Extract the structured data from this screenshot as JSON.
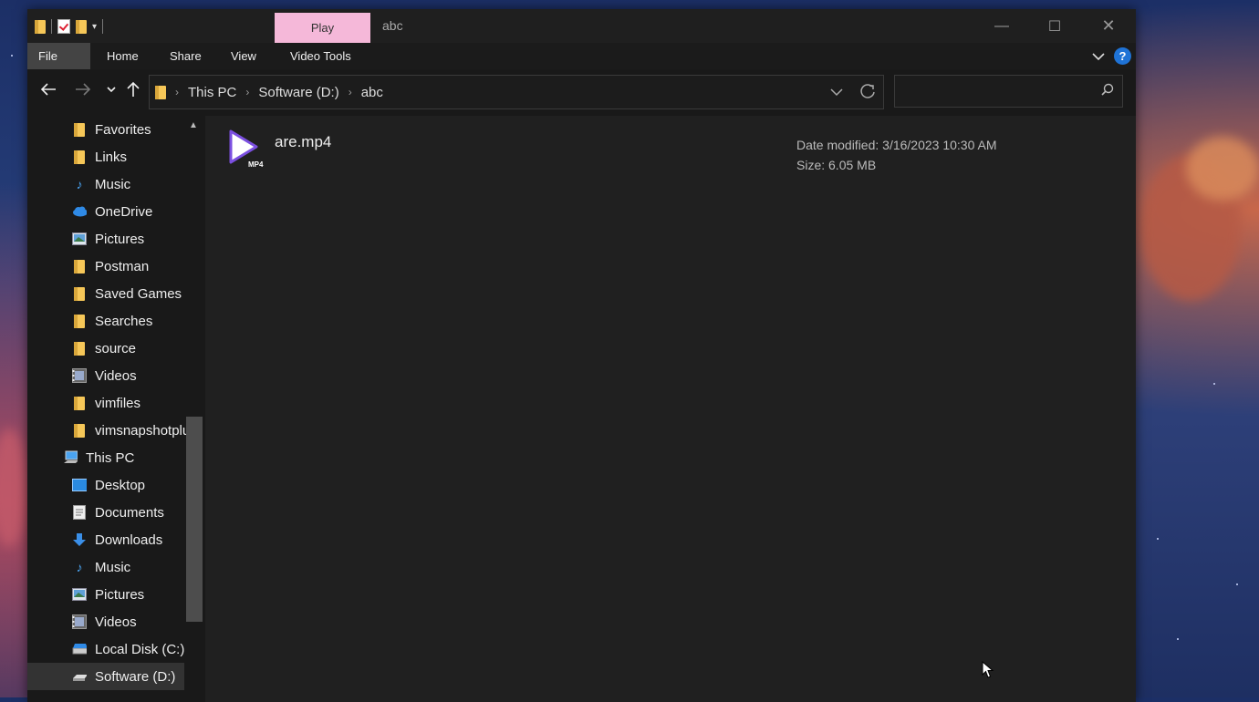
{
  "window": {
    "title": "abc",
    "contextual_tab": "Play",
    "controls": {
      "minimize": "—",
      "maximize": "☐",
      "close": "✕"
    }
  },
  "ribbon": {
    "tabs": [
      "File",
      "Home",
      "Share",
      "View",
      "Video Tools"
    ],
    "expand_icon": "chevron-down-icon",
    "help": "?"
  },
  "navigation": {
    "breadcrumb": [
      "This PC",
      "Software (D:)",
      "abc"
    ],
    "search_placeholder": ""
  },
  "sidebar": {
    "items": [
      {
        "label": "Favorites",
        "icon": "folder-star-icon"
      },
      {
        "label": "Links",
        "icon": "folder-link-icon"
      },
      {
        "label": "Music",
        "icon": "music-note-icon"
      },
      {
        "label": "OneDrive",
        "icon": "cloud-icon"
      },
      {
        "label": "Pictures",
        "icon": "pictures-icon"
      },
      {
        "label": "Postman",
        "icon": "folder-icon"
      },
      {
        "label": "Saved Games",
        "icon": "saved-games-icon"
      },
      {
        "label": "Searches",
        "icon": "searches-icon"
      },
      {
        "label": "source",
        "icon": "folder-icon"
      },
      {
        "label": "Videos",
        "icon": "videos-icon"
      },
      {
        "label": "vimfiles",
        "icon": "folder-icon"
      },
      {
        "label": "vimsnapshotplu",
        "icon": "folder-icon"
      },
      {
        "label": "This PC",
        "icon": "computer-icon"
      },
      {
        "label": "Desktop",
        "icon": "desktop-icon"
      },
      {
        "label": "Documents",
        "icon": "documents-icon"
      },
      {
        "label": "Downloads",
        "icon": "download-icon"
      },
      {
        "label": "Music",
        "icon": "music-note-icon"
      },
      {
        "label": "Pictures",
        "icon": "pictures-icon"
      },
      {
        "label": "Videos",
        "icon": "videos-icon"
      },
      {
        "label": "Local Disk (C:)",
        "icon": "drive-icon"
      },
      {
        "label": "Software (D:)",
        "icon": "drive-icon",
        "selected": true
      }
    ]
  },
  "files": [
    {
      "name": "are.mp4",
      "icon": "mp4-video-icon",
      "date_modified": "Date modified: 3/16/2023 10:30 AM",
      "size": "Size: 6.05 MB",
      "icon_text": "MP4"
    }
  ],
  "colors": {
    "accent": "#1f73d6",
    "play_tab": "#f5b8d9",
    "window_bg": "#191919",
    "content_bg": "#202020"
  }
}
